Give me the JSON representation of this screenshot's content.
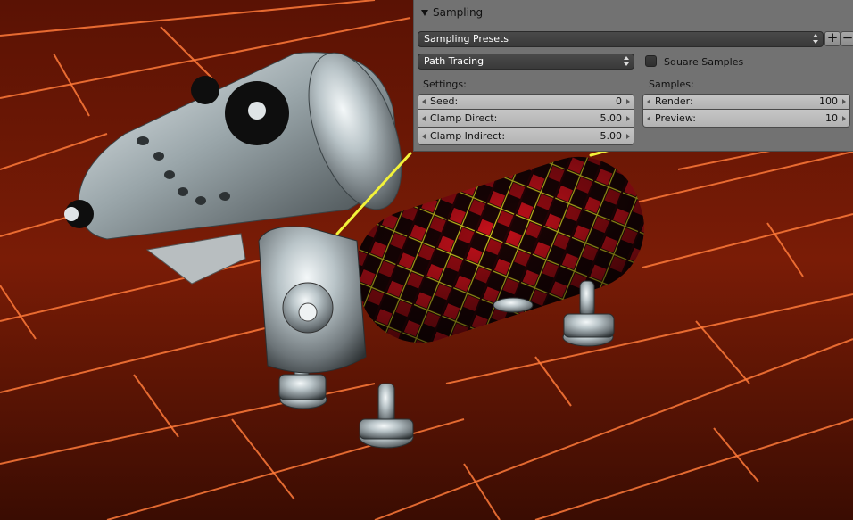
{
  "panel": {
    "title": "Sampling",
    "presets_label": "Sampling Presets",
    "add_icon": "plus-icon",
    "remove_icon": "minus-icon",
    "integrator": "Path Tracing",
    "square_samples_label": "Square Samples",
    "square_samples_checked": false,
    "settings_heading": "Settings:",
    "samples_heading": "Samples:",
    "settings": [
      {
        "label": "Seed:",
        "value": "0"
      },
      {
        "label": "Clamp Direct:",
        "value": "5.00"
      },
      {
        "label": "Clamp Indirect:",
        "value": "5.00"
      }
    ],
    "samples": [
      {
        "label": "Render:",
        "value": "100"
      },
      {
        "label": "Preview:",
        "value": "10"
      }
    ]
  },
  "colors": {
    "floor_plank": "#8a2208",
    "floor_glow": "#ff7a3a",
    "plaid_red": "#c4101a",
    "plaid_yellow": "#d8d020",
    "metal": "#c9d0d3",
    "annotation": "#f2f23a",
    "panel_bg": "#727272"
  }
}
